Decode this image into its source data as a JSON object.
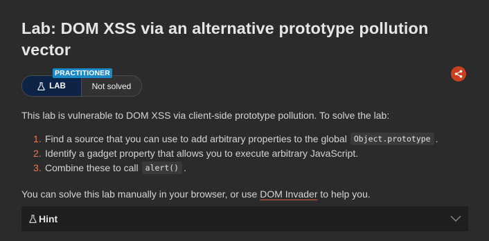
{
  "lab": {
    "title": "Lab: DOM XSS via an alternative prototype pollution vector",
    "level_badge": "PRACTITIONER",
    "type_label": "LAB",
    "status": "Not solved"
  },
  "description": {
    "intro": "This lab is vulnerable to DOM XSS via client-side prototype pollution. To solve the lab:",
    "steps": [
      {
        "num": "1.",
        "text": "Find a source that you can use to add arbitrary properties to the global",
        "code": "Object.prototype",
        "suffix": "."
      },
      {
        "num": "2.",
        "text": "Identify a gadget property that allows you to execute arbitrary JavaScript.",
        "code": "",
        "suffix": ""
      },
      {
        "num": "3.",
        "text": "Combine these to call",
        "code": "alert()",
        "suffix": "."
      }
    ],
    "outro_before": "You can solve this lab manually in your browser, or use",
    "outro_link": "DOM Invader",
    "outro_after": "to help you."
  },
  "hint": {
    "label": "Hint"
  },
  "icons": {
    "share": "share-icon",
    "flask": "flask-icon",
    "chevron": "chevron-down-icon"
  },
  "colors": {
    "background": "#2b2b2b",
    "accent": "#f2754d",
    "share": "#c8401f",
    "badge_level": "#1b8bc8",
    "badge_lab": "#0e2447"
  }
}
